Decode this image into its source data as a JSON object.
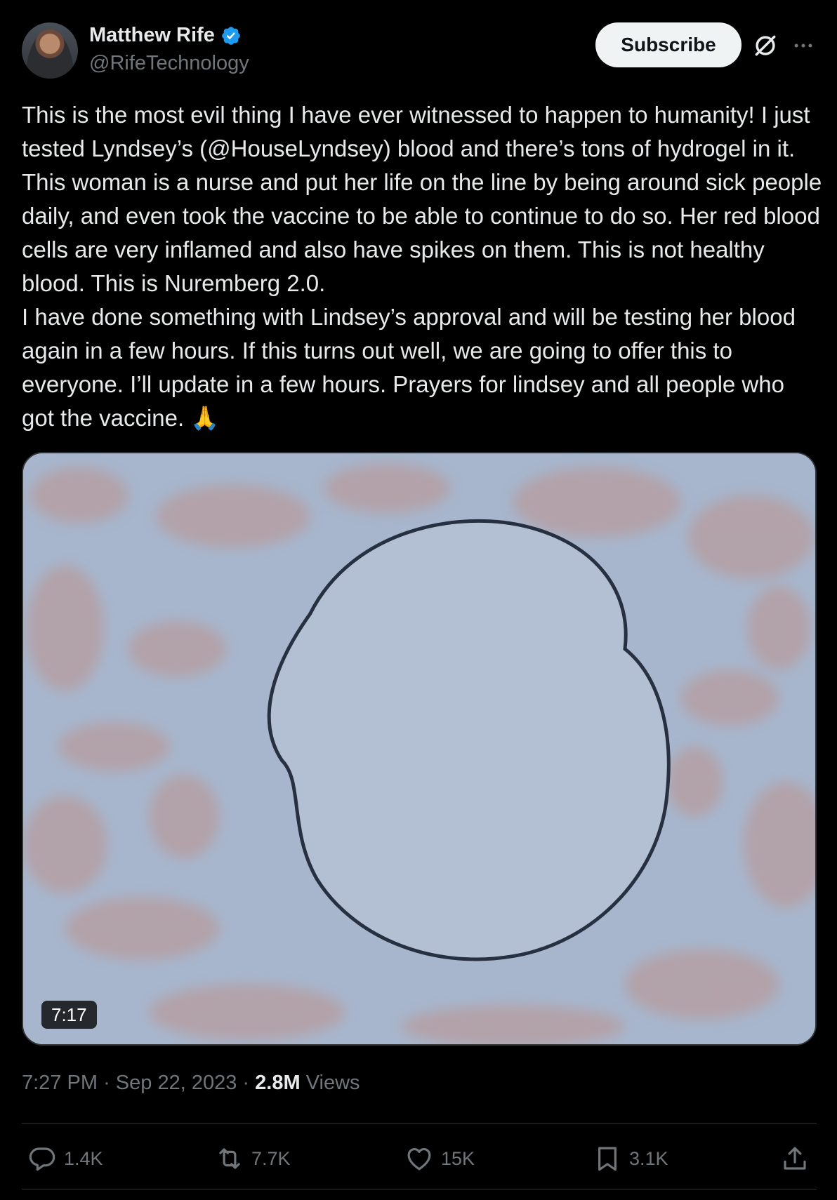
{
  "author": {
    "name": "Matthew Rife",
    "handle": "@RifeTechnology",
    "verified": true
  },
  "header": {
    "subscribe_label": "Subscribe"
  },
  "tweet": {
    "text": "This is the most evil thing I have ever witnessed to happen to humanity! I just tested Lyndsey’s (@HouseLyndsey) blood and there’s tons of hydrogel in it. This woman is a nurse and put her life on the line by being around sick people daily, and even took the vaccine to be able to continue to do so. Her red blood cells are very inflamed and also have spikes on them. This is not healthy blood. This is Nuremberg 2.0.\nI have done something with Lindsey’s approval and will be testing her blood again in a few hours. If this turns out well, we are going to offer this to everyone. I’ll update in a few hours. Prayers for lindsey and all people who got the vaccine. 🙏"
  },
  "media": {
    "duration": "7:17"
  },
  "meta": {
    "time": "7:27 PM",
    "sep1": "·",
    "date": "Sep 22, 2023",
    "sep2": "·",
    "views_count": "2.8M",
    "views_label": "Views"
  },
  "actions": {
    "replies": "1.4K",
    "reposts": "7.7K",
    "likes": "15K",
    "bookmarks": "3.1K"
  },
  "colors": {
    "background": "#000000",
    "text": "#e7e9ea",
    "muted": "#71767b",
    "verified": "#1d9bf0",
    "subscribe_bg": "#eff3f4"
  }
}
